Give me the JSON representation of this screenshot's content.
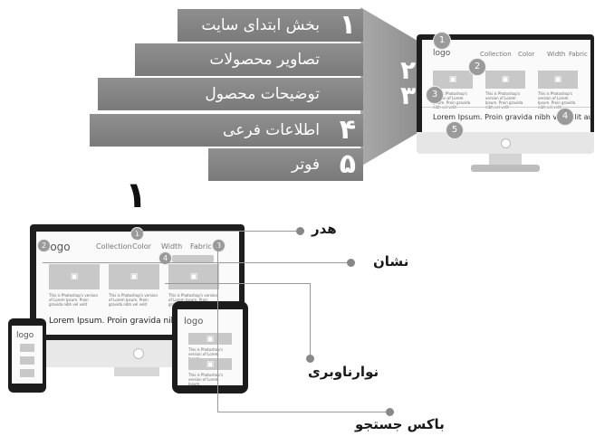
{
  "top_steps": [
    {
      "num": "۱",
      "label": "بخش ابتدای سایت"
    },
    {
      "num": "۲",
      "label": "تصاویر محصولات"
    },
    {
      "num": "۳",
      "label": "توضیحات محصول"
    },
    {
      "num": "۴",
      "label": "اطلاعات فرعی"
    },
    {
      "num": "۵",
      "label": "فوتر"
    }
  ],
  "top_monitor": {
    "logo": "logo",
    "nav": [
      "Collection",
      "Color",
      "Width",
      "Fabric"
    ],
    "thumb_text": "This is Photoshop's version of Lorem Ipsum. Proin gravida nibh vel velit",
    "footer_text": "Lorem Ipsum. Proin gravida nibh vel velit auctor",
    "badges": [
      "1",
      "2",
      "3",
      "4",
      "5"
    ]
  },
  "section_number": "۱",
  "bottom_desktop": {
    "logo": "logo",
    "nav": [
      "Collection",
      "Color",
      "Width",
      "Fabric"
    ],
    "thumb_text": "This is Photoshop's version of Lorem Ipsum. Proin gravida nibh vel velit",
    "footer_text": "Lorem Ipsum. Proin gravida nibh",
    "badges": [
      "1",
      "2",
      "3",
      "4"
    ]
  },
  "tablet": {
    "logo": "logo",
    "thumb_text": "This is Photoshop's version of Lorem Ipsum."
  },
  "phone": {
    "logo": "logo"
  },
  "callouts": {
    "header": "هدر",
    "badge": "نشان",
    "navbar": "نوارناوبری",
    "search_box": "باکس جستجو"
  }
}
